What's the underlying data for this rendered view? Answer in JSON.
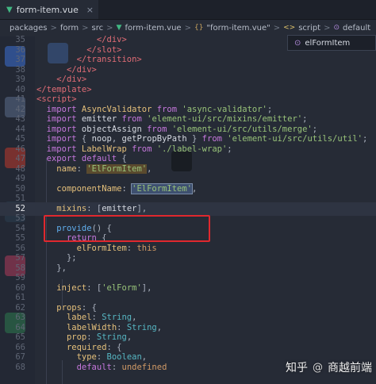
{
  "tab": {
    "title": "form-item.vue",
    "close_glyph": "×",
    "icon": "vue-icon"
  },
  "breadcrumb": {
    "parts": [
      "packages",
      "form",
      "src",
      "form-item.vue",
      "\"form-item.vue\"",
      "script",
      "default"
    ],
    "separator": ">"
  },
  "outline_popup": {
    "label": "elFormItem"
  },
  "editor": {
    "current_line": "52",
    "lines": [
      {
        "no": "35",
        "text": "            </div>"
      },
      {
        "no": "36",
        "text": "          </slot>"
      },
      {
        "no": "37",
        "text": "        </transition>"
      },
      {
        "no": "38",
        "text": "      </div>"
      },
      {
        "no": "39",
        "text": "    </div>"
      },
      {
        "no": "40",
        "text": "</template>"
      },
      {
        "no": "41",
        "text": "<script>"
      },
      {
        "no": "42",
        "text": "  import AsyncValidator from 'async-validator';"
      },
      {
        "no": "43",
        "text": "  import emitter from 'element-ui/src/mixins/emitter';"
      },
      {
        "no": "44",
        "text": "  import objectAssign from 'element-ui/src/utils/merge';"
      },
      {
        "no": "45",
        "text": "  import { noop, getPropByPath } from 'element-ui/src/utils/util';"
      },
      {
        "no": "46",
        "text": "  import LabelWrap from './label-wrap';"
      },
      {
        "no": "47",
        "text": "  export default {"
      },
      {
        "no": "48",
        "text": "    name: 'ElFormItem',"
      },
      {
        "no": "49",
        "text": ""
      },
      {
        "no": "50",
        "text": "    componentName: 'ElFormItem',"
      },
      {
        "no": "51",
        "text": ""
      },
      {
        "no": "52",
        "text": "    mixins: [emitter],"
      },
      {
        "no": "53",
        "text": ""
      },
      {
        "no": "54",
        "text": "    provide() {"
      },
      {
        "no": "55",
        "text": "      return {"
      },
      {
        "no": "56",
        "text": "        elFormItem: this"
      },
      {
        "no": "57",
        "text": "      };"
      },
      {
        "no": "58",
        "text": "    },"
      },
      {
        "no": "59",
        "text": ""
      },
      {
        "no": "60",
        "text": "    inject: ['elForm'],"
      },
      {
        "no": "61",
        "text": ""
      },
      {
        "no": "62",
        "text": "    props: {"
      },
      {
        "no": "63",
        "text": "      label: String,"
      },
      {
        "no": "64",
        "text": "      labelWidth: String,"
      },
      {
        "no": "65",
        "text": "      prop: String,"
      },
      {
        "no": "66",
        "text": "      required: {"
      },
      {
        "no": "67",
        "text": "        type: Boolean,"
      },
      {
        "no": "68",
        "text": "        default: undefined"
      }
    ]
  },
  "watermark": {
    "brand": "知乎",
    "separator": "@",
    "author": "商越前端"
  },
  "colors": {
    "background": "#262b36",
    "highlight_border": "#e0282e",
    "vue_green": "#41b883"
  }
}
